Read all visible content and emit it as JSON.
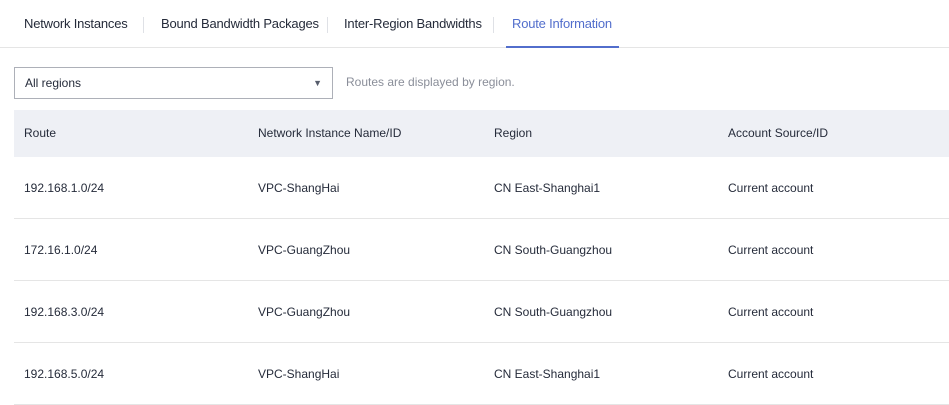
{
  "tabs": [
    {
      "label": "Network Instances",
      "active": false
    },
    {
      "label": "Bound Bandwidth Packages",
      "active": false
    },
    {
      "label": "Inter-Region Bandwidths",
      "active": false
    },
    {
      "label": "Route Information",
      "active": true
    }
  ],
  "filter": {
    "region_value": "All regions",
    "dropdown_icon": "chevron-down-icon",
    "hint": "Routes are displayed by region."
  },
  "table": {
    "columns": [
      "Route",
      "Network Instance Name/ID",
      "Region",
      "Account Source/ID"
    ],
    "rows": [
      {
        "route": "192.168.1.0/24",
        "instance": "VPC-ShangHai",
        "region": "CN East-Shanghai1",
        "account": "Current account"
      },
      {
        "route": "172.16.1.0/24",
        "instance": "VPC-GuangZhou",
        "region": "CN South-Guangzhou",
        "account": "Current account"
      },
      {
        "route": "192.168.3.0/24",
        "instance": "VPC-GuangZhou",
        "region": "CN South-Guangzhou",
        "account": "Current account"
      },
      {
        "route": "192.168.5.0/24",
        "instance": "VPC-ShangHai",
        "region": "CN East-Shanghai1",
        "account": "Current account"
      }
    ]
  },
  "colors": {
    "accent": "#526ecc",
    "header_bg": "#eef0f5"
  }
}
